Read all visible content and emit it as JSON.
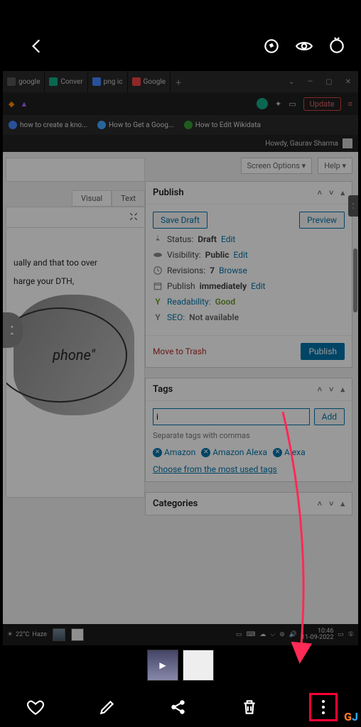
{
  "topbar": {
    "back": "‹"
  },
  "browser": {
    "tabs": [
      "google",
      "Conver",
      "png ic",
      "Google"
    ],
    "update": "Update",
    "bookmarks": [
      "how to create a kno...",
      "How to Get a Goog...",
      "How to Edit Wikidata"
    ],
    "howdy": "Howdy, Gaurav Sharma"
  },
  "wp": {
    "screen_options": "Screen Options ▾",
    "help": "Help ▾",
    "editor_tabs": {
      "visual": "Visual",
      "text": "Text"
    },
    "editor_lines": [
      "ually and that too over",
      "harge your DTH,"
    ],
    "editor_img_text": "phone\"",
    "publish": {
      "title": "Publish",
      "save_draft": "Save Draft",
      "preview": "Preview",
      "status_label": "Status:",
      "status_value": "Draft",
      "edit": "Edit",
      "visibility_label": "Visibility:",
      "visibility_value": "Public",
      "revisions_label": "Revisions:",
      "revisions_value": "7",
      "browse": "Browse",
      "publish_label": "Publish",
      "publish_value": "immediately",
      "readability_label": "Readability:",
      "readability_value": "Good",
      "seo_label": "SEO:",
      "seo_value": "Not available",
      "trash": "Move to Trash",
      "publish_btn": "Publish"
    },
    "tags": {
      "title": "Tags",
      "input": "i",
      "add": "Add",
      "hint": "Separate tags with commas",
      "chips": [
        "Amazon",
        "Amazon Alexa",
        "Alexa"
      ],
      "choose": "Choose from the most used tags"
    },
    "categories": "Categories"
  },
  "taskbar": {
    "temp": "22°C",
    "cond": "Haze",
    "time": "10:46",
    "date": "11-09-2022"
  },
  "watermark": {
    "g": "G",
    "j": "J"
  }
}
